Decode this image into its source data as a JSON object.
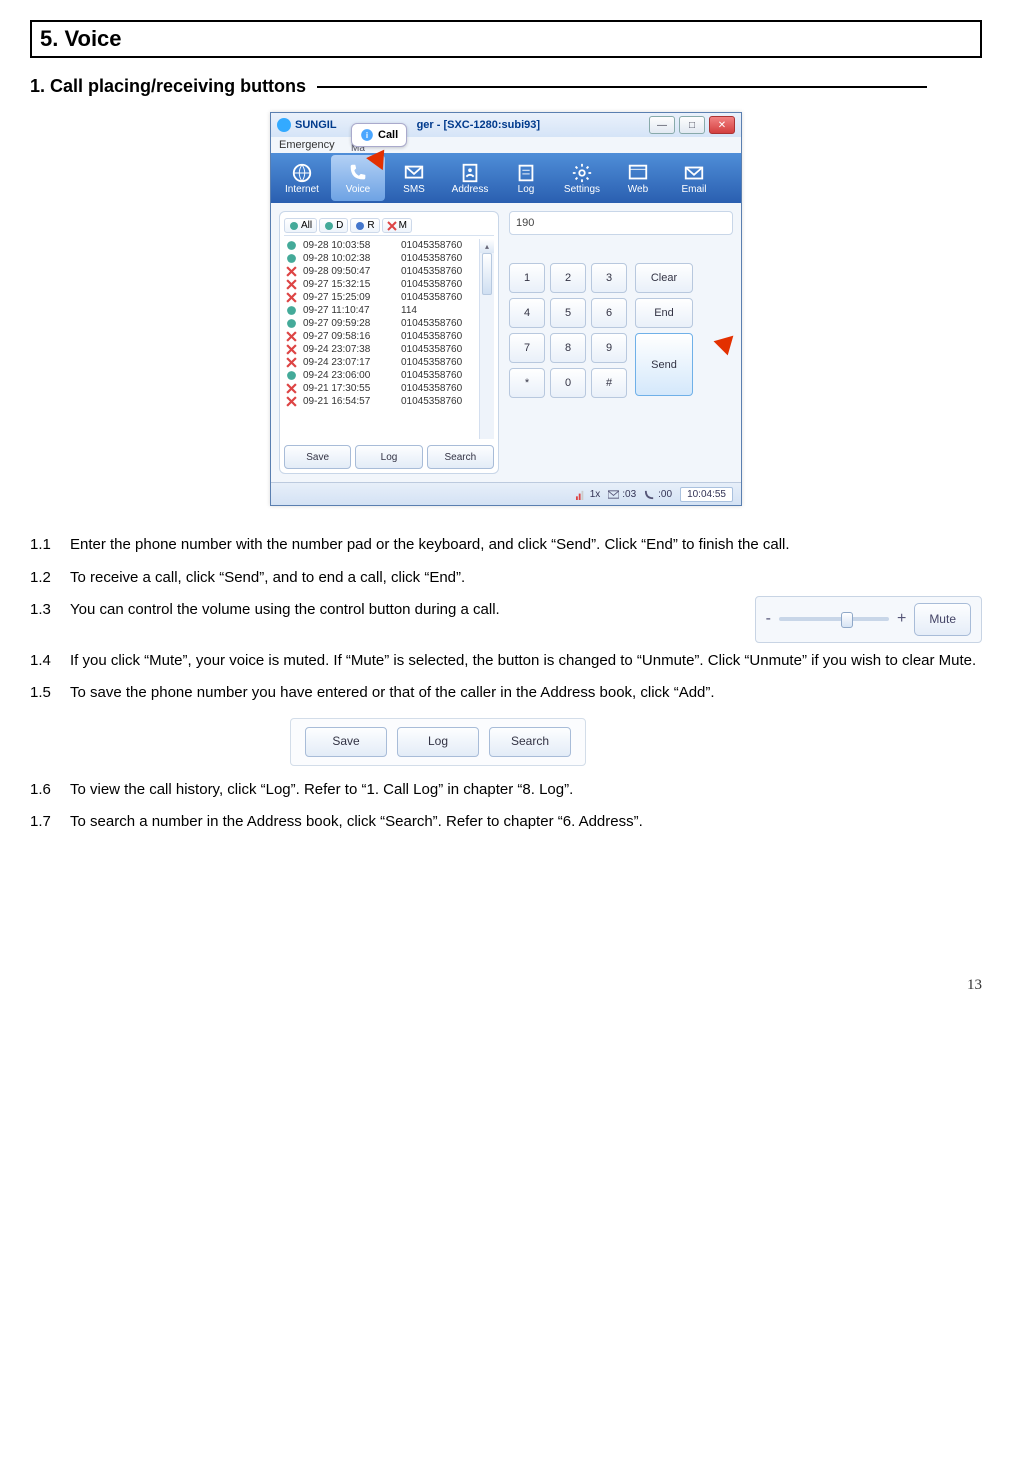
{
  "section_title": "5. Voice",
  "subsection_title": "1. Call placing/receiving buttons",
  "screenshot": {
    "titlebar_prefix": "SUNGIL",
    "titlebar_suffix": "ger - [SXC-1280:subi93]",
    "menubar": "Emergency",
    "call_bubble": "Call",
    "call_bubble_sub": "Ma",
    "toolbar": [
      {
        "label": "Internet",
        "name": "internet-icon"
      },
      {
        "label": "Voice",
        "name": "voice-icon",
        "active": true
      },
      {
        "label": "SMS",
        "name": "sms-icon"
      },
      {
        "label": "Address",
        "name": "address-icon"
      },
      {
        "label": "Log",
        "name": "log-icon"
      },
      {
        "label": "Settings",
        "name": "settings-icon"
      },
      {
        "label": "Web",
        "name": "web-icon"
      },
      {
        "label": "Email",
        "name": "email-icon"
      }
    ],
    "filters": [
      "All",
      "D",
      "R",
      "M"
    ],
    "dial_display": "190",
    "log_rows": [
      {
        "ts": "09-28 10:03:58",
        "num": "01045358760",
        "t": "d"
      },
      {
        "ts": "09-28 10:02:38",
        "num": "01045358760",
        "t": "d"
      },
      {
        "ts": "09-28 09:50:47",
        "num": "01045358760",
        "t": "m"
      },
      {
        "ts": "09-27 15:32:15",
        "num": "01045358760",
        "t": "m"
      },
      {
        "ts": "09-27 15:25:09",
        "num": "01045358760",
        "t": "m"
      },
      {
        "ts": "09-27 11:10:47",
        "num": "114",
        "t": "d"
      },
      {
        "ts": "09-27 09:59:28",
        "num": "01045358760",
        "t": "d"
      },
      {
        "ts": "09-27 09:58:16",
        "num": "01045358760",
        "t": "m"
      },
      {
        "ts": "09-24 23:07:38",
        "num": "01045358760",
        "t": "m"
      },
      {
        "ts": "09-24 23:07:17",
        "num": "01045358760",
        "t": "m"
      },
      {
        "ts": "09-24 23:06:00",
        "num": "01045358760",
        "t": "d"
      },
      {
        "ts": "09-21 17:30:55",
        "num": "01045358760",
        "t": "m"
      },
      {
        "ts": "09-21 16:54:57",
        "num": "01045358760",
        "t": "m"
      }
    ],
    "log_buttons": {
      "save": "Save",
      "log": "Log",
      "search": "Search"
    },
    "keypad": [
      "1",
      "2",
      "3",
      "4",
      "5",
      "6",
      "7",
      "8",
      "9",
      "*",
      "0",
      "#"
    ],
    "side_keys": {
      "clear": "Clear",
      "end": "End",
      "send": "Send"
    },
    "status": {
      "sig": "1x",
      "msg": ":03",
      "time": ":00",
      "clock": "10:04:55"
    }
  },
  "volume_fig": {
    "minus": "-",
    "plus": "+",
    "mute": "Mute"
  },
  "instructions": [
    {
      "n": "1.1",
      "t": "Enter the phone number with the number pad or the keyboard, and click “Send”. Click “End” to finish the call."
    },
    {
      "n": "1.2",
      "t": "To receive a call, click “Send”, and to end a call, click “End”."
    },
    {
      "n": "1.3",
      "t": "You can control the volume using the control button during a call.",
      "fig": "vol"
    },
    {
      "n": "1.4",
      "t": "If you click “Mute”, your voice is muted. If “Mute” is selected, the button is changed to “Unmute”. Click “Unmute” if you wish to clear Mute."
    },
    {
      "n": "1.5",
      "t": "To save the phone number you have entered or that of the caller in the Address book, click “Add”.",
      "fig": "btns"
    },
    {
      "n": "1.6",
      "t": "To view the call history, click “Log”. Refer to “1. Call Log” in chapter “8. Log”."
    },
    {
      "n": "1.7",
      "t": "To search a number in the Address book, click “Search”. Refer to chapter “6. Address”."
    }
  ],
  "page_number": "13"
}
